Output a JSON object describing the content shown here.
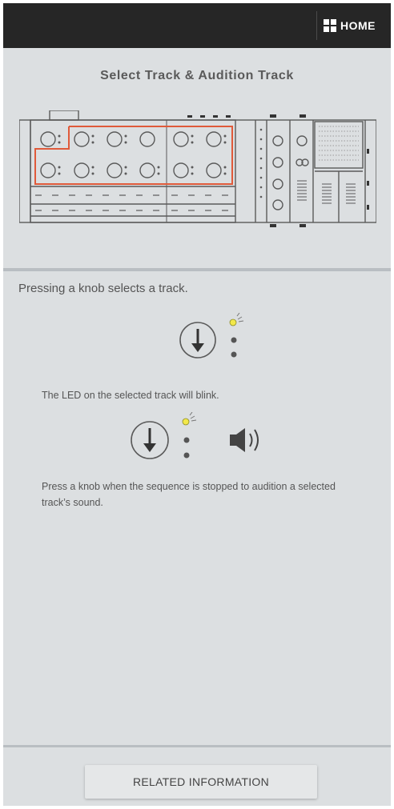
{
  "topbar": {
    "home_label": "HOME",
    "home_icon": "grid-icon"
  },
  "header": {
    "title": "Select Track & Audition Track"
  },
  "content": {
    "intro": "Pressing a knob selects a track.",
    "led_caption": "The LED on the selected track will blink.",
    "audition_caption": "Press a knob when the sequence is stopped to audition a selected track’s sound."
  },
  "footer": {
    "related_label": "RELATED INFORMATION"
  },
  "colors": {
    "highlight": "#e05a3a",
    "led": "#f2e84a",
    "line": "#5a5a5a"
  }
}
